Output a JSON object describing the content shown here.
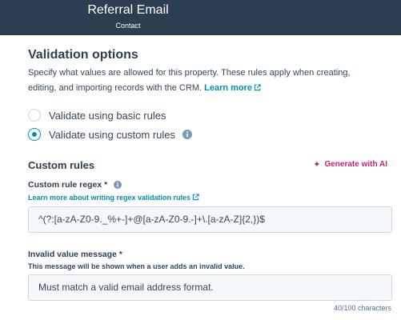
{
  "header": {
    "title": "Referral Email",
    "subtitle": "Contact"
  },
  "validation": {
    "title": "Validation options",
    "description": "Specify what values are allowed for this property. These rules apply when creating, editing, and importing records with the CRM.",
    "learn_more": "Learn more",
    "options": [
      {
        "label": "Validate using basic rules",
        "checked": false
      },
      {
        "label": "Validate using custom rules",
        "checked": true
      }
    ]
  },
  "custom_rules": {
    "title": "Custom rules",
    "generate_ai": "Generate with AI",
    "regex_label": "Custom rule regex *",
    "regex_help_link": "Learn more about writing regex validation rules",
    "regex_value": "^(?:[a-zA-Z0-9._%+-]+@[a-zA-Z0-9.-]+\\.[a-zA-Z]{2,})$",
    "message_label": "Invalid value message *",
    "message_help": "This message will be shown when a user adds an invalid value.",
    "message_value": "Must match a valid email address format.",
    "char_count": "40/100 characters"
  },
  "colors": {
    "header_bg": "#2d3e50",
    "link": "#0091ae",
    "ai_accent": "#c5246d",
    "input_bg": "#f5f8fa"
  },
  "icons": {
    "external": "external-link-icon",
    "info": "info-icon",
    "sparkle": "sparkle-icon"
  }
}
